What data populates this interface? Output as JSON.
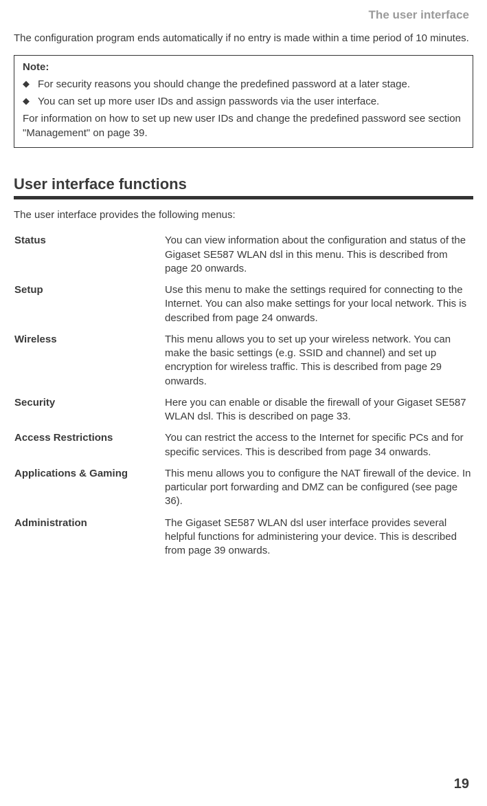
{
  "header": {
    "title": "The user interface"
  },
  "intro": "The configuration program ends automatically if no entry is made within a time period of 10 minutes.",
  "note": {
    "title": "Note:",
    "bullets": [
      "For security reasons you should change the predefined password at a later stage.",
      "You can set up more user IDs and assign passwords via the user interface."
    ],
    "footer": "For information on how to set up new user IDs and change the predefined password see section \"Management\" on page 39."
  },
  "section": {
    "heading": "User interface functions",
    "intro": "The user interface provides the following menus:"
  },
  "menus": [
    {
      "term": "Status",
      "desc": "You can view information about the configuration and status of the Gigaset SE587 WLAN dsl in this menu. This is described from page 20 onwards."
    },
    {
      "term": "Setup",
      "desc": "Use this menu to make the settings required for connecting to the Internet. You can also make settings for your local network. This is described from page 24 onwards."
    },
    {
      "term": "Wireless",
      "desc": "This menu allows you to set up your wireless network. You can make the basic settings (e.g. SSID and channel) and set up encryption for wireless traffic. This is described from page 29 onwards."
    },
    {
      "term": "Security",
      "desc": "Here you can enable or disable the firewall of your Gigaset SE587 WLAN dsl. This is described on page 33."
    },
    {
      "term": "Access Restrictions",
      "desc": "You can restrict the access to the Internet for specific PCs and for specific services. This is described from page 34 onwards."
    },
    {
      "term": "Applications & Gaming",
      "desc": "This menu allows you to configure the NAT firewall of the device. In particular port forwarding and DMZ can be configured (see page 36)."
    },
    {
      "term": "Administration",
      "desc": "The Gigaset SE587 WLAN dsl user interface provides several helpful functions for administering your device. This is described from page 39 onwards."
    }
  ],
  "pageNumber": "19"
}
